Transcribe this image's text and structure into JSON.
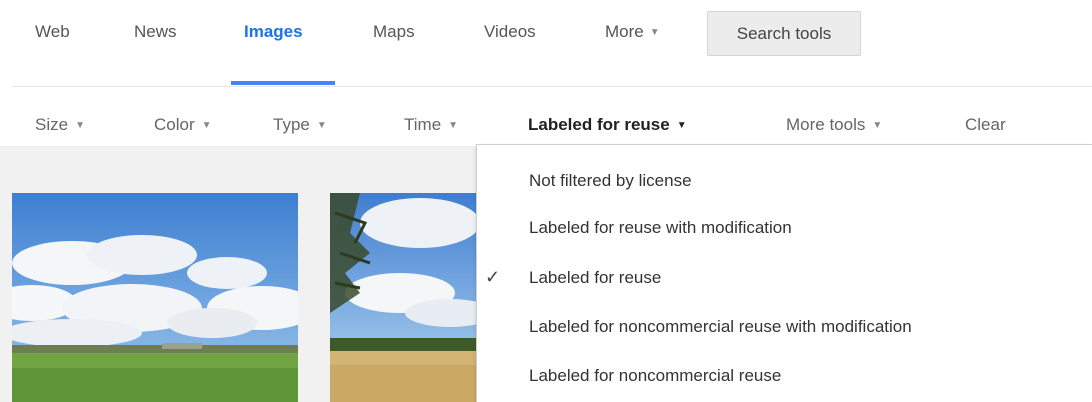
{
  "nav": {
    "tabs": [
      {
        "label": "Web"
      },
      {
        "label": "News"
      },
      {
        "label": "Images"
      },
      {
        "label": "Maps"
      },
      {
        "label": "Videos"
      },
      {
        "label": "More"
      }
    ],
    "active_tab": "Images",
    "search_tools_label": "Search tools"
  },
  "tools": {
    "items": [
      {
        "label": "Size"
      },
      {
        "label": "Color"
      },
      {
        "label": "Type"
      },
      {
        "label": "Time"
      },
      {
        "label": "Labeled for reuse"
      },
      {
        "label": "More tools"
      }
    ],
    "clear_label": "Clear"
  },
  "license_menu": {
    "options": [
      {
        "label": "Not filtered by license"
      },
      {
        "label": "Labeled for reuse with modification"
      },
      {
        "label": "Labeled for reuse"
      },
      {
        "label": "Labeled for noncommercial reuse with modification"
      },
      {
        "label": "Labeled for noncommercial reuse"
      }
    ],
    "selected_index": 2,
    "check_glyph": "✓"
  },
  "colors": {
    "accent": "#4285f4",
    "active_tab_text": "#1a73e8",
    "results_bg": "#f1f1f1"
  }
}
